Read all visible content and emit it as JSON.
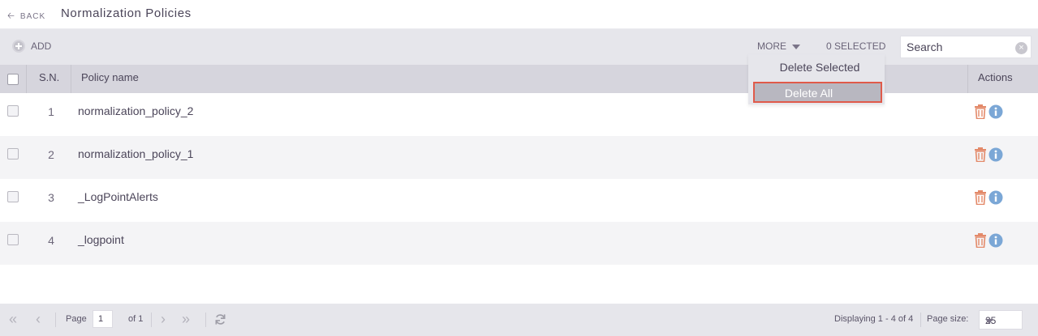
{
  "header": {
    "back_label": "BACK",
    "title": "Normalization Policies"
  },
  "toolbar": {
    "add_label": "ADD",
    "more_label": "MORE",
    "selected_count": "0 SELECTED",
    "search_placeholder": "Search"
  },
  "more_menu": {
    "items": [
      "Delete Selected",
      "Delete All"
    ],
    "highlighted": "Delete All"
  },
  "table": {
    "columns": {
      "sn": "S.N.",
      "policy_name": "Policy name",
      "actions": "Actions"
    },
    "rows": [
      {
        "sn": "1",
        "name": "normalization_policy_2"
      },
      {
        "sn": "2",
        "name": "normalization_policy_1"
      },
      {
        "sn": "3",
        "name": "_LogPointAlerts"
      },
      {
        "sn": "4",
        "name": "_logpoint"
      }
    ]
  },
  "pagination": {
    "page_label": "Page",
    "current_page": "1",
    "of_label": "of 1",
    "displaying": "Displaying 1 - 4 of 4",
    "page_size_label": "Page size:",
    "page_size": "25"
  },
  "colors": {
    "trash": "#e38a6a",
    "info": "#7ba7d6",
    "highlight_border": "#e05a4a"
  }
}
